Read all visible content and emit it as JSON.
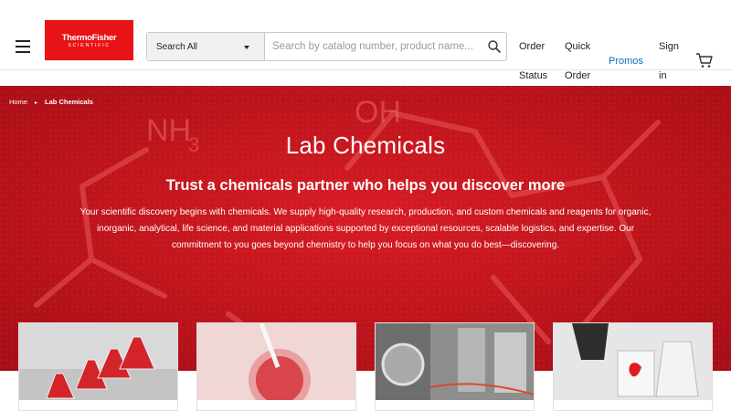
{
  "header": {
    "logo_line1": "ThermoFisher",
    "logo_line2": "SCIENTIFIC",
    "search_category": "Search All",
    "search_placeholder": "Search by catalog number, product name...",
    "nav": {
      "order_status": "Order Status",
      "quick_order": "Quick Order",
      "promos": "Promos",
      "sign_in": "Sign in"
    }
  },
  "breadcrumb": {
    "home": "Home",
    "separator": "▸",
    "current": "Lab Chemicals"
  },
  "hero": {
    "title": "Lab Chemicals",
    "subtitle": "Trust a chemicals partner who helps you discover more",
    "body": "Your scientific discovery begins with chemicals. We supply high-quality research, production, and custom chemicals and reagents for organic, inorganic, analytical, life science, and material applications supported by exceptional resources, scalable logistics, and expertise. Our commitment to you goes beyond chemistry to help you focus on what you do best—discovering.",
    "background_molecule_labels": [
      "NH₃",
      "OH"
    ]
  },
  "cards": [
    {
      "image": "red-flasks-photo"
    },
    {
      "image": "pipette-red-liquid-photo"
    },
    {
      "image": "steel-tanks-photo"
    },
    {
      "image": "beakers-red-drop-photo"
    }
  ],
  "colors": {
    "brand_red": "#e71316",
    "hero_red": "#c8151d",
    "link_blue": "#0a6fb4"
  }
}
